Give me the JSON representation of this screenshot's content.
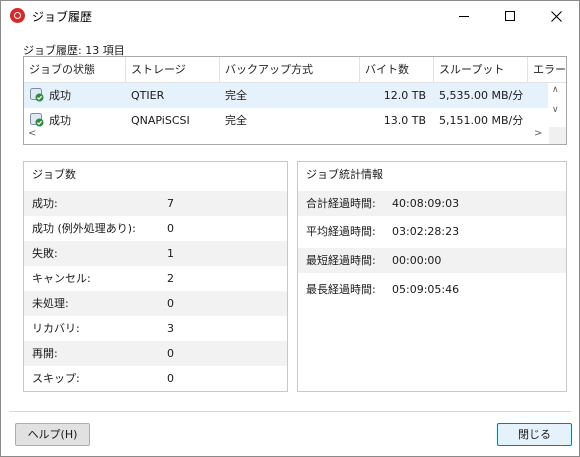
{
  "window": {
    "title": "ジョブ履歴"
  },
  "summary": {
    "count_label": "ジョブ履歴: 13 項目"
  },
  "table": {
    "columns": [
      "ジョブの状態",
      "ストレージ",
      "バックアップ方式",
      "バイト数",
      "スループット",
      "エラー"
    ],
    "rows": [
      {
        "status": "成功",
        "storage": "QTIER",
        "method": "完全",
        "bytes": "12.0 TB",
        "throughput": "5,535.00 MB/分",
        "selected": true
      },
      {
        "status": "成功",
        "storage": "QNAPiSCSI",
        "method": "完全",
        "bytes": "13.0 TB",
        "throughput": "5,151.00 MB/分",
        "selected": false
      }
    ]
  },
  "job_counts": {
    "heading": "ジョブ数",
    "items": [
      {
        "label": "成功:",
        "value": "7"
      },
      {
        "label": "成功 (例外処理あり):",
        "value": "0"
      },
      {
        "label": "失敗:",
        "value": "1"
      },
      {
        "label": "キャンセル:",
        "value": "2"
      },
      {
        "label": "未処理:",
        "value": "0"
      },
      {
        "label": "リカバリ:",
        "value": "3"
      },
      {
        "label": "再開:",
        "value": "0"
      },
      {
        "label": "スキップ:",
        "value": "0"
      }
    ]
  },
  "job_stats": {
    "heading": "ジョブ統計情報",
    "items": [
      {
        "label": "合計経過時間:",
        "value": "40:08:09:03"
      },
      {
        "label": "平均経過時間:",
        "value": "03:02:28:23"
      },
      {
        "label": "最短経過時間:",
        "value": "00:00:00"
      },
      {
        "label": "最長経過時間:",
        "value": "05:09:05:46"
      }
    ]
  },
  "buttons": {
    "help": "ヘルプ(H)",
    "close": "閉じる"
  },
  "colors": {
    "accent": "#0078d7",
    "selected_row": "#e5f1fb",
    "success_icon": "#2e8b3a",
    "app_icon": "#d42a2a"
  },
  "icons": {
    "app": "app-logo-icon",
    "status_success": "success-check-icon"
  }
}
